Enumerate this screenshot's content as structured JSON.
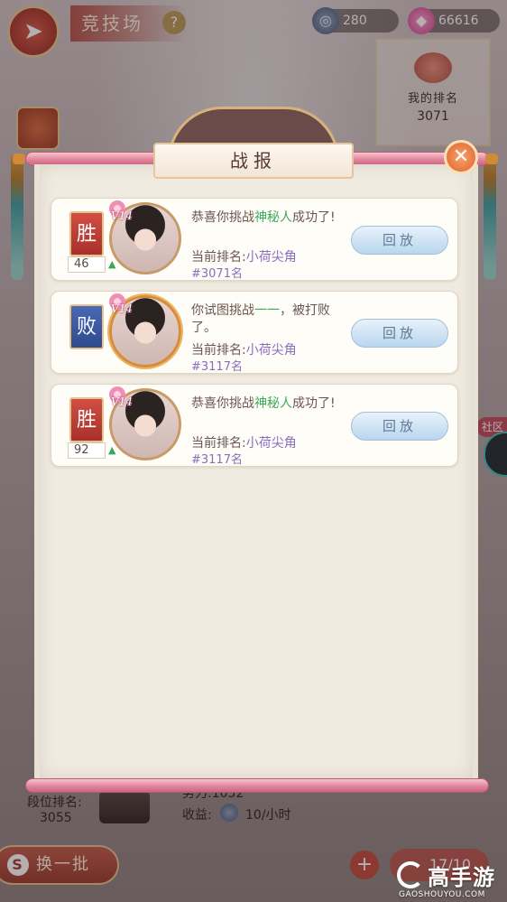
{
  "header": {
    "title": "竞技场",
    "help_icon": "?",
    "back_icon": "back-arrow-icon"
  },
  "currencies": {
    "silver": {
      "icon": "silver-coin-icon",
      "value": "280"
    },
    "gems": {
      "icon": "gem-icon",
      "value": "66616"
    }
  },
  "my_rank": {
    "label": "我的排名",
    "value": "3071"
  },
  "dialog": {
    "title": "战报",
    "close_icon": "✕",
    "records": [
      {
        "result": "胜",
        "result_type": "win",
        "score": "46",
        "vip": "V14",
        "msg_pre": "恭喜你挑战",
        "opponent": "神秘人",
        "msg_post": "成功了!",
        "rank_prefix": "当前排名:",
        "nickname": "小荷尖角",
        "rank_num": "#3071名",
        "replay_label": "回放"
      },
      {
        "result": "败",
        "result_type": "lose",
        "score": "",
        "vip": "V14",
        "msg_pre": "你试图挑战",
        "opponent": "一一",
        "msg_post": "，被打败了。",
        "rank_prefix": "当前排名:",
        "nickname": "小荷尖角",
        "rank_num": "#3117名",
        "replay_label": "回放"
      },
      {
        "result": "胜",
        "result_type": "win",
        "score": "92",
        "vip": "V14",
        "msg_pre": "恭喜你挑战",
        "opponent": "神秘人",
        "msg_post": "成功了!",
        "rank_prefix": "当前排名:",
        "nickname": "小荷尖角",
        "rank_num": "#3117名",
        "replay_label": "回放"
      }
    ]
  },
  "side": {
    "community_label": "社区"
  },
  "bottom": {
    "duan_label": "段位排名:",
    "duan_value": "3055",
    "power_text": "势力:1052",
    "income_label": "收益:",
    "income_value": "10/小时",
    "swap_label": "换一批",
    "count_text": "17/10"
  },
  "watermark": {
    "brand": "高手游",
    "url": "GAOSHOUYOU.COM"
  }
}
